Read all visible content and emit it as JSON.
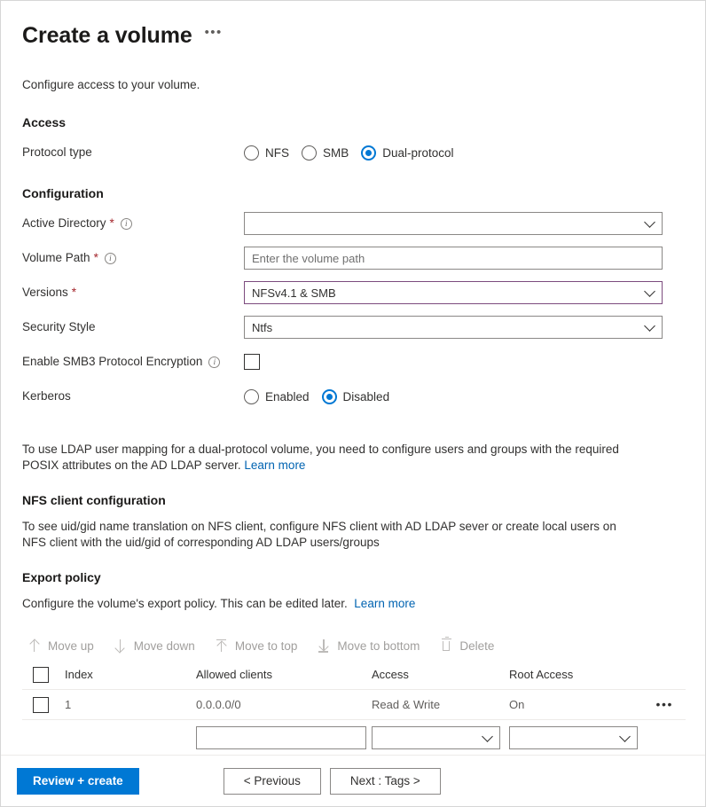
{
  "header": {
    "title": "Create a volume",
    "ellipsis": "•••"
  },
  "intro": "Configure access to your volume.",
  "access": {
    "section_title": "Access",
    "protocol_label": "Protocol type",
    "protocol_options": [
      {
        "label": "NFS",
        "checked": false
      },
      {
        "label": "SMB",
        "checked": false
      },
      {
        "label": "Dual-protocol",
        "checked": true
      }
    ]
  },
  "configuration": {
    "section_title": "Configuration",
    "active_directory": {
      "label": "Active Directory",
      "required": "*",
      "info": "i",
      "value": "",
      "placeholder": ""
    },
    "volume_path": {
      "label": "Volume Path",
      "required": "*",
      "info": "i",
      "value": "",
      "placeholder": "Enter the volume path"
    },
    "versions": {
      "label": "Versions",
      "required": "*",
      "value": "NFSv4.1 & SMB",
      "invalid_border_color": "#7c4b7e"
    },
    "security_style": {
      "label": "Security Style",
      "value": "Ntfs"
    },
    "smb3_encryption": {
      "label": "Enable SMB3 Protocol Encryption",
      "info": "i",
      "checked": false
    },
    "kerberos": {
      "label": "Kerberos",
      "options": [
        {
          "label": "Enabled",
          "checked": false
        },
        {
          "label": "Disabled",
          "checked": true
        }
      ]
    }
  },
  "ldap_note": {
    "text": "To use LDAP user mapping for a dual-protocol volume, you need to configure users and groups with the required POSIX attributes on the AD LDAP server.",
    "link": "Learn more"
  },
  "nfs_client": {
    "section_title": "NFS client configuration",
    "text": "To see uid/gid name translation on NFS client, configure NFS client with AD LDAP sever or create local users on NFS client with the uid/gid of corresponding AD LDAP users/groups"
  },
  "export_policy": {
    "section_title": "Export policy",
    "text": "Configure the volume's export policy. This can be edited later.",
    "link": "Learn more",
    "toolbar": [
      {
        "label": "Move up",
        "icon": "arrow-up-icon",
        "disabled": true
      },
      {
        "label": "Move down",
        "icon": "arrow-down-icon",
        "disabled": true
      },
      {
        "label": "Move to top",
        "icon": "arrow-to-top-icon",
        "disabled": true
      },
      {
        "label": "Move to bottom",
        "icon": "arrow-to-bottom-icon",
        "disabled": true
      },
      {
        "label": "Delete",
        "icon": "trash-icon",
        "disabled": true
      }
    ],
    "table": {
      "columns": [
        "Index",
        "Allowed clients",
        "Access",
        "Root Access"
      ],
      "rows": [
        {
          "index": "1",
          "allowed_clients": "0.0.0.0/0",
          "access": "Read & Write",
          "root_access": "On",
          "row_menu": "•••"
        }
      ],
      "new_row": {
        "allowed_clients": "",
        "access": "",
        "root_access": ""
      }
    }
  },
  "footer": {
    "review_create": "Review + create",
    "previous": "< Previous",
    "next": "Next : Tags >",
    "primary_color": "#0078d4"
  }
}
